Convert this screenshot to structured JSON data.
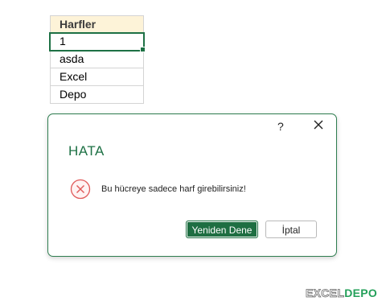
{
  "sheet": {
    "header": "Harfler",
    "rows": [
      "1",
      "asda",
      "Excel",
      "Depo"
    ],
    "accent_color": "#1e7145"
  },
  "dialog": {
    "help_label": "?",
    "title": "HATA",
    "icon": "error-circle-x-icon",
    "message": "Bu hücreye sadece harf girebilirsiniz!",
    "retry_label": "Yeniden Dene",
    "cancel_label": "İptal",
    "accent_color": "#1e7145",
    "error_color": "#e05a5a"
  },
  "watermark": {
    "part1": "EXCEL",
    "part2": "DEPO"
  }
}
